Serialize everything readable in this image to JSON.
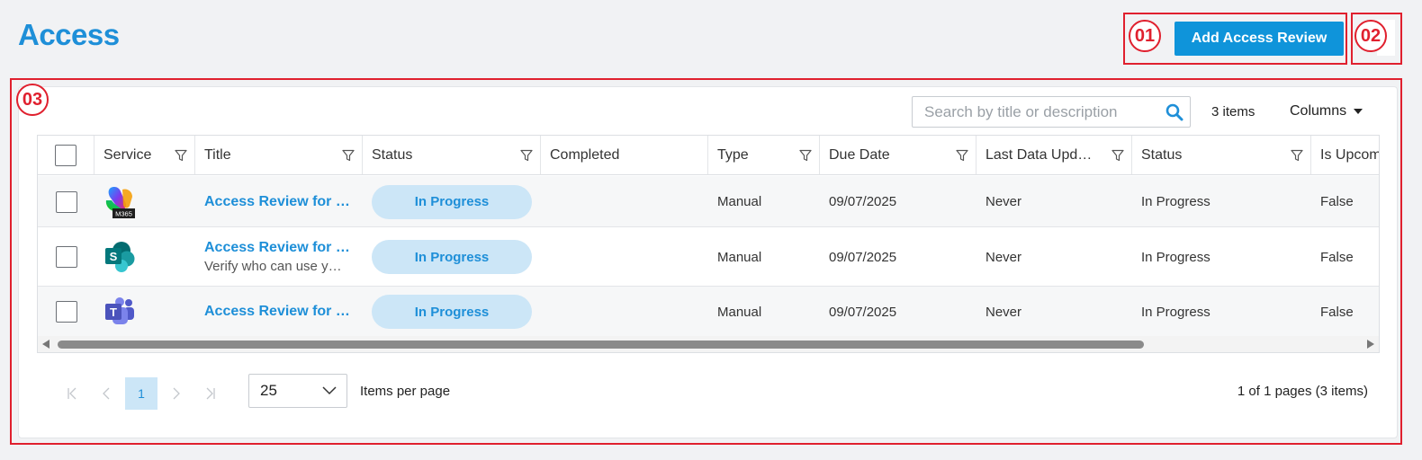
{
  "page": {
    "title": "Access"
  },
  "actions": {
    "add_label": "Add Access Review"
  },
  "annotations": [
    "01",
    "02",
    "03"
  ],
  "toolbar": {
    "search_placeholder": "Search by title or description",
    "item_count": "3 items",
    "columns_label": "Columns"
  },
  "grid": {
    "columns": [
      "Service",
      "Title",
      "Status",
      "Completed",
      "Type",
      "Due Date",
      "Last Data Upd…",
      "Status",
      "Is Upcom"
    ],
    "rows": [
      {
        "service_icon": "m365-icon",
        "service_badge": "M365",
        "title": "Access Review for …",
        "description": "",
        "status": "In Progress",
        "completed": "",
        "type": "Manual",
        "due_date": "09/07/2025",
        "last_update": "Never",
        "status2": "In Progress",
        "upcoming": "False"
      },
      {
        "service_icon": "sharepoint-icon",
        "title": "Access Review for …",
        "description": "Verify who can use y…",
        "status": "In Progress",
        "completed": "",
        "type": "Manual",
        "due_date": "09/07/2025",
        "last_update": "Never",
        "status2": "In Progress",
        "upcoming": "False"
      },
      {
        "service_icon": "teams-icon",
        "title": "Access Review for …",
        "description": "",
        "status": "In Progress",
        "completed": "",
        "type": "Manual",
        "due_date": "09/07/2025",
        "last_update": "Never",
        "status2": "In Progress",
        "upcoming": "False"
      }
    ]
  },
  "pagination": {
    "current_page": "1",
    "page_size": "25",
    "items_per_page_label": "Items per page",
    "page_info": "1 of 1 pages (3 items)"
  },
  "colors": {
    "accent": "#1e8fd8",
    "button": "#0f94da",
    "pill_bg": "#cce6f7",
    "annotation": "#e0202e"
  }
}
